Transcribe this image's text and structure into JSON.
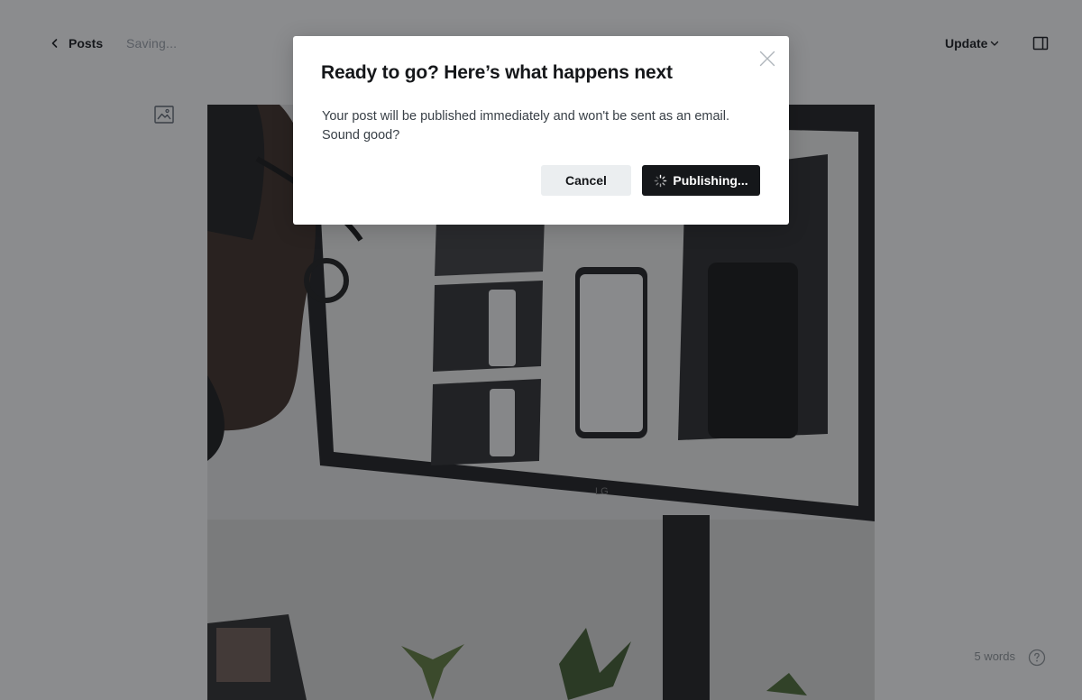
{
  "header": {
    "back_label": "Posts",
    "status": "Saving...",
    "update_label": "Update"
  },
  "editor": {
    "word_count": "5 words"
  },
  "modal": {
    "title": "Ready to go? Here’s what happens next",
    "body_line1": "Your post will be published immediately and won't be sent as an email.",
    "body_line2": "Sound good?",
    "cancel_label": "Cancel",
    "confirm_label": "Publishing..."
  },
  "icons": {
    "back": "chevron-left-icon",
    "update": "chevron-down-icon",
    "sidebar": "sidebar-toggle-icon",
    "feature_image": "image-icon",
    "help": "help-circle-icon",
    "close": "close-icon",
    "spinner": "spinner-icon"
  },
  "colors": {
    "primary_button": "#15171a",
    "secondary_button": "#ebeef0",
    "overlay": "rgba(24,26,30,0.5)",
    "muted_text": "#9aa1a9"
  }
}
